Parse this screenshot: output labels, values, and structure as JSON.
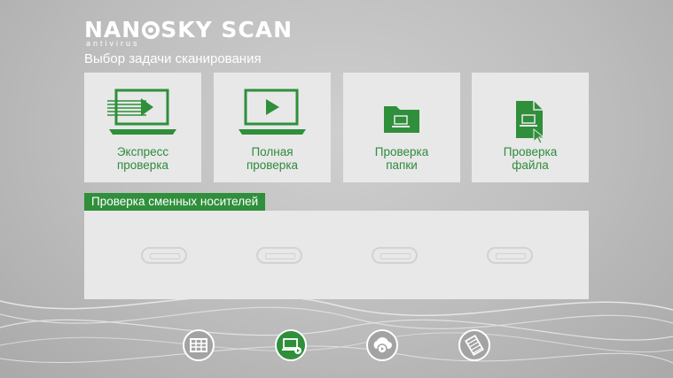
{
  "brand": {
    "name_part1": "NAN",
    "name_part2": "SKY SCAN",
    "subtitle": "antivirus"
  },
  "page": {
    "title": "Выбор задачи сканирования"
  },
  "tiles": [
    {
      "line1": "Экспресс",
      "line2": "проверка",
      "icon": "express-scan-laptop-icon"
    },
    {
      "line1": "Полная",
      "line2": "проверка",
      "icon": "full-scan-laptop-icon"
    },
    {
      "line1": "Проверка",
      "line2": "папки",
      "icon": "folder-icon"
    },
    {
      "line1": "Проверка",
      "line2": "файла",
      "icon": "file-icon"
    }
  ],
  "removable": {
    "title": "Проверка сменных носителей",
    "slots": 4
  },
  "nav": [
    {
      "icon": "dashboard-icon",
      "active": false
    },
    {
      "icon": "scan-icon",
      "active": true
    },
    {
      "icon": "cloud-update-icon",
      "active": false
    },
    {
      "icon": "quarantine-icon",
      "active": false
    }
  ],
  "colors": {
    "accent": "#2f8f3b",
    "tile_bg": "#e8e8e8",
    "text_green": "#2e8b3d"
  }
}
